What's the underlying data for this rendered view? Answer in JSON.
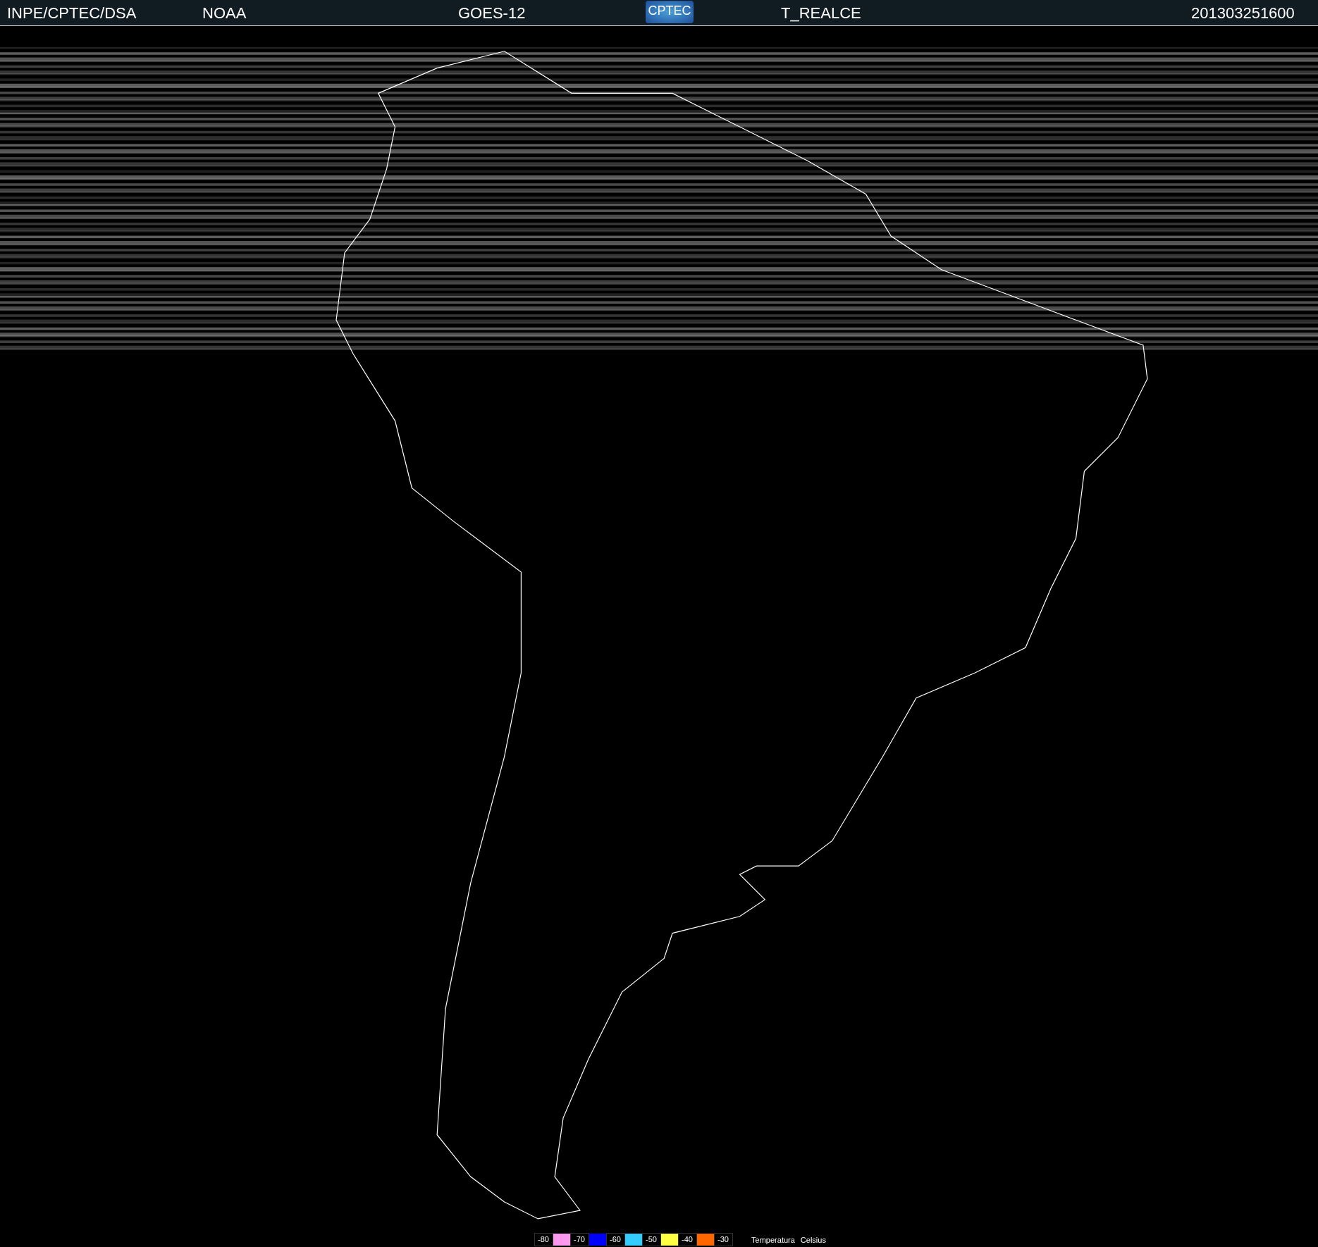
{
  "header": {
    "source": "INPE/CPTEC/DSA",
    "agency": "NOAA",
    "satellite": "GOES-12",
    "logo_text": "CPTEC",
    "product": "T_REALCE",
    "timestamp": "201303251600"
  },
  "legend": {
    "stops": [
      {
        "label": "-80",
        "color": "#ff99ee"
      },
      {
        "label": "-70",
        "color": "#0000ff"
      },
      {
        "label": "-60",
        "color": "#33ccff"
      },
      {
        "label": "-50",
        "color": "#ffff44"
      },
      {
        "label": "-40",
        "color": "#ff6600"
      },
      {
        "label": "-30"
      }
    ],
    "title": "Temperatura",
    "unit": "Celsius"
  }
}
